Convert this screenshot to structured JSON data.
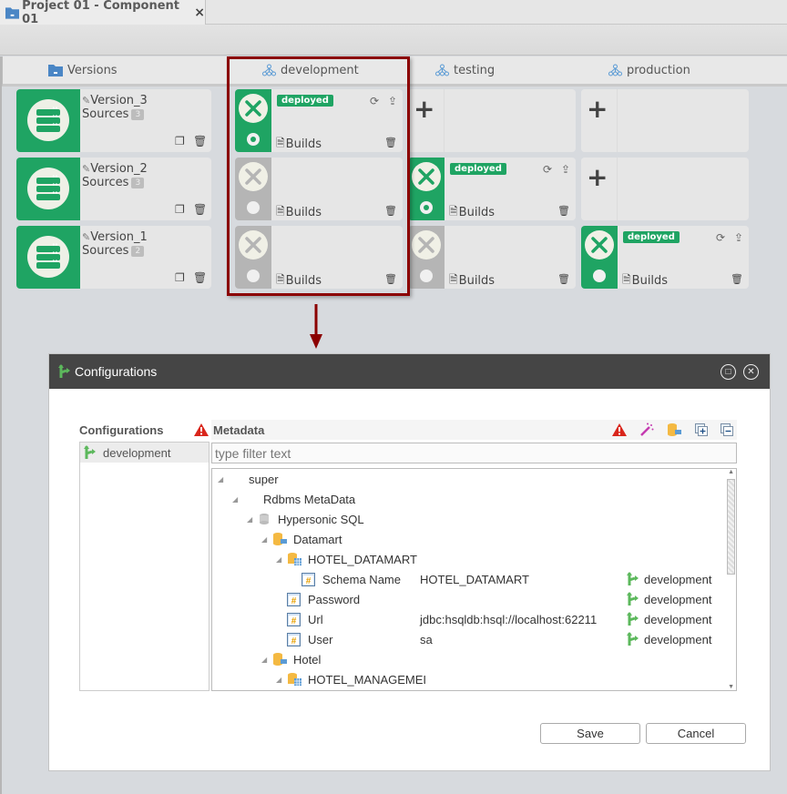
{
  "tab": {
    "title": "Project 01 - Component 01",
    "close": "×"
  },
  "columns": {
    "versions": "Versions",
    "environments": [
      "development",
      "testing",
      "production"
    ]
  },
  "versions": [
    {
      "name": "Version_3",
      "sources_label": "Sources",
      "sources_count": "3"
    },
    {
      "name": "Version_2",
      "sources_label": "Sources",
      "sources_count": "3"
    },
    {
      "name": "Version_1",
      "sources_label": "Sources",
      "sources_count": "2"
    }
  ],
  "grid": {
    "deployed_label": "deployed",
    "builds_label": "Builds",
    "add_label": "+"
  },
  "dialog": {
    "title": "Configurations",
    "configurations_header": "Configurations",
    "configurations": [
      {
        "label": "development"
      }
    ],
    "metadata_header": "Metadata",
    "filter_placeholder": "type filter text",
    "tree": [
      {
        "label": "super",
        "level": 0
      },
      {
        "label": "Rdbms MetaData",
        "level": 1
      },
      {
        "label": "Hypersonic SQL",
        "level": 2
      },
      {
        "label": "Datamart",
        "level": 3
      },
      {
        "label": "HOTEL_DATAMART",
        "level": 4
      },
      {
        "label": "Schema Name",
        "level": 5,
        "value": "HOTEL_DATAMART",
        "config": "development"
      },
      {
        "label": "Password",
        "level": 4,
        "value": "",
        "config": "development"
      },
      {
        "label": "Url",
        "level": 4,
        "value": "jdbc:hsqldb:hsql://localhost:62211",
        "config": "development"
      },
      {
        "label": "User",
        "level": 4,
        "value": "sa",
        "config": "development"
      },
      {
        "label": "Hotel",
        "level": 3
      },
      {
        "label": "HOTEL_MANAGEMEI",
        "level": 4
      }
    ],
    "save_label": "Save",
    "cancel_label": "Cancel"
  },
  "colors": {
    "green": "#1fa463",
    "highlight": "#8b0000",
    "header": "#454545"
  }
}
